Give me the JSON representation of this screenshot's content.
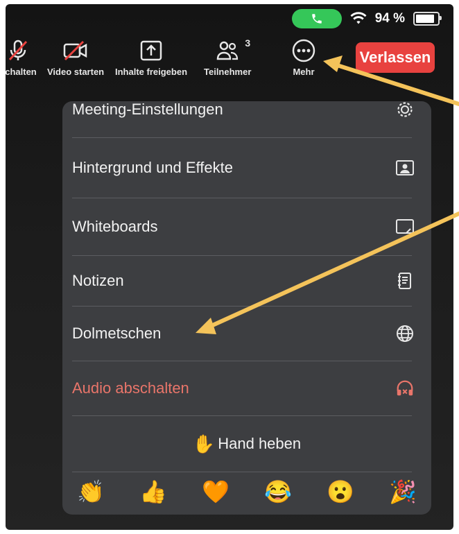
{
  "status_bar": {
    "wifi_icon": "wifi-icon",
    "battery_text": "94 %",
    "battery_level": 0.94
  },
  "toolbar": {
    "mute_label": "schalten",
    "video_label": "Video starten",
    "share_label": "Inhalte freigeben",
    "participants_label": "Teilnehmer",
    "participants_count": "3",
    "more_label": "Mehr",
    "leave_label": "Verlassen"
  },
  "menu": {
    "items": [
      {
        "label": "Meeting-Einstellungen",
        "icon": "gear-icon"
      },
      {
        "label": "Hintergrund und Effekte",
        "icon": "portrait-icon"
      },
      {
        "label": "Whiteboards",
        "icon": "whiteboard-icon"
      },
      {
        "label": "Notizen",
        "icon": "notes-icon"
      },
      {
        "label": "Dolmetschen",
        "icon": "globe-icon"
      },
      {
        "label": "Audio abschalten",
        "icon": "headphones-off-icon"
      }
    ],
    "raise_hand_label": "Hand heben",
    "reactions": [
      "👏",
      "👍",
      "🧡",
      "😂",
      "😮",
      "🎉"
    ]
  },
  "colors": {
    "accent_green": "#35c759",
    "leave_red": "#e8423f",
    "danger_text": "#e9756a",
    "annotation_arrow": "#f4c35a"
  }
}
